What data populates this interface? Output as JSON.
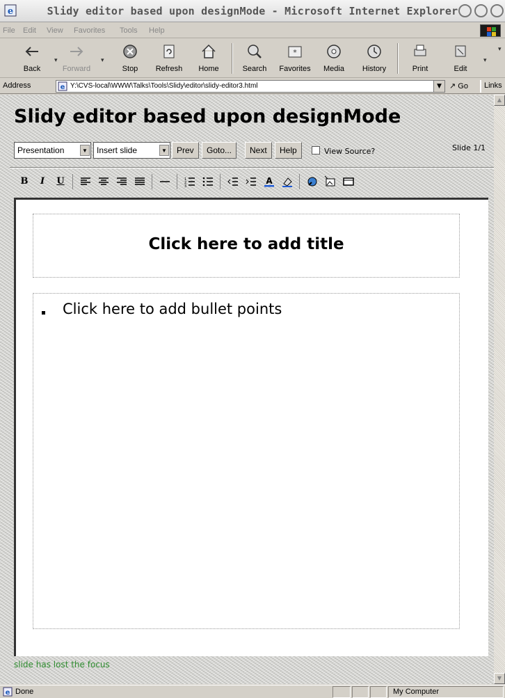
{
  "window": {
    "title": "Slidy editor based upon designMode - Microsoft Internet Explorer"
  },
  "menu": {
    "items": [
      "File",
      "Edit",
      "View",
      "Favorites",
      "Tools",
      "Help"
    ]
  },
  "toolbar": {
    "back": "Back",
    "forward": "Forward",
    "stop": "Stop",
    "refresh": "Refresh",
    "home": "Home",
    "search": "Search",
    "favorites": "Favorites",
    "media": "Media",
    "history": "History",
    "print": "Print",
    "edit": "Edit"
  },
  "address": {
    "label": "Address",
    "url": "Y:\\CVS-local\\WWW\\Talks\\Tools\\Slidy\\editor\\slidy-editor3.html",
    "go": "Go",
    "links": "Links"
  },
  "page": {
    "heading": "Slidy editor based upon designMode",
    "presentation_select": "Presentation",
    "insert_select": "Insert slide",
    "prev": "Prev",
    "goto": "Goto...",
    "next": "Next",
    "help": "Help",
    "view_source_label": "View Source?",
    "view_source_checked": false,
    "slide_count": "Slide 1/1",
    "formatting": {
      "bold": "B",
      "italic": "I",
      "underline": "U"
    },
    "slide_title_placeholder": "Click here to add title",
    "slide_bullet_placeholder": "Click here to add bullet points",
    "status_message": "slide has lost the focus"
  },
  "statusbar": {
    "text": "Done",
    "zone": "My Computer"
  },
  "colors": {
    "status_message": "#2e8b2e",
    "chrome": "#d4d0c8"
  }
}
